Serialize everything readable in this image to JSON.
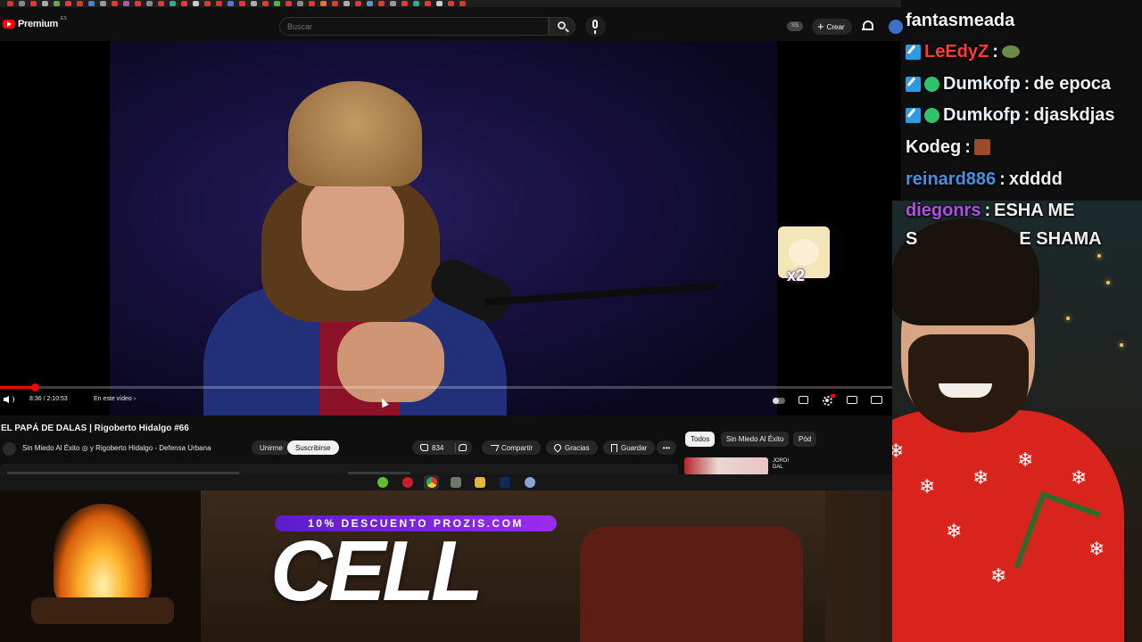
{
  "youtube": {
    "logo_text": "Premium",
    "region": "ES",
    "search_placeholder": "Buscar",
    "cast_label": "SS",
    "create_label": "Crear",
    "player": {
      "progress": 0.04,
      "time": "8:36 / 2:10:53",
      "chapter": "En este vídeo ›",
      "sticker_text": "x2"
    },
    "video_title": "EL PAPÁ DE DALAS | Rigoberto Hidalgo #66",
    "channel_name": "Sin Miedo Al Éxito ◎ y Rigoberto Hidalgo - Defensa Urbana",
    "join_label": "Unirme",
    "subscribe_label": "Suscribirse",
    "like_count": "834",
    "share_label": "Compartir",
    "thanks_label": "Gracias",
    "save_label": "Guardar",
    "more_label": "•••",
    "chips": [
      "Todos",
      "Sin Miedo Al Éxito",
      "Pód"
    ],
    "rec_title": "JORDI\nDAL"
  },
  "overlay": {
    "promo_text": "10% DESCUENTO PROZIS.COM",
    "brand_text": "CELL"
  },
  "chat": {
    "messages": [
      {
        "user": "fantasmeada",
        "sep": "",
        "text": "",
        "user_color": "#f4f4f4"
      },
      {
        "user": "LeEdyZ",
        "sep": ":",
        "text": "",
        "user_color": "#ff3a3a"
      },
      {
        "user": "Dumkofp",
        "sep": ":",
        "text": "de epoca",
        "user_color": "#e8f0f8"
      },
      {
        "user": "Dumkofp",
        "sep": ":",
        "text": "djaskdjas",
        "user_color": "#e8f0f8"
      },
      {
        "user": "Kodeg",
        "sep": ":",
        "text": "",
        "user_color": "#f4f4f4"
      },
      {
        "user": "reinard886",
        "sep": ":",
        "text": "xdddd",
        "user_color": "#4a90e2"
      },
      {
        "user": "diegonrs",
        "sep": ":",
        "text": "ESHA ME",
        "user_color": "#b150e0"
      },
      {
        "user": "S",
        "sep": "",
        "text": "E SHAMA",
        "user_color": "#f4f4f4"
      }
    ]
  },
  "colors": {
    "yt_red": "#ff0000",
    "promo_purple": "#7b26e0",
    "sweater_red": "#d8241d"
  }
}
